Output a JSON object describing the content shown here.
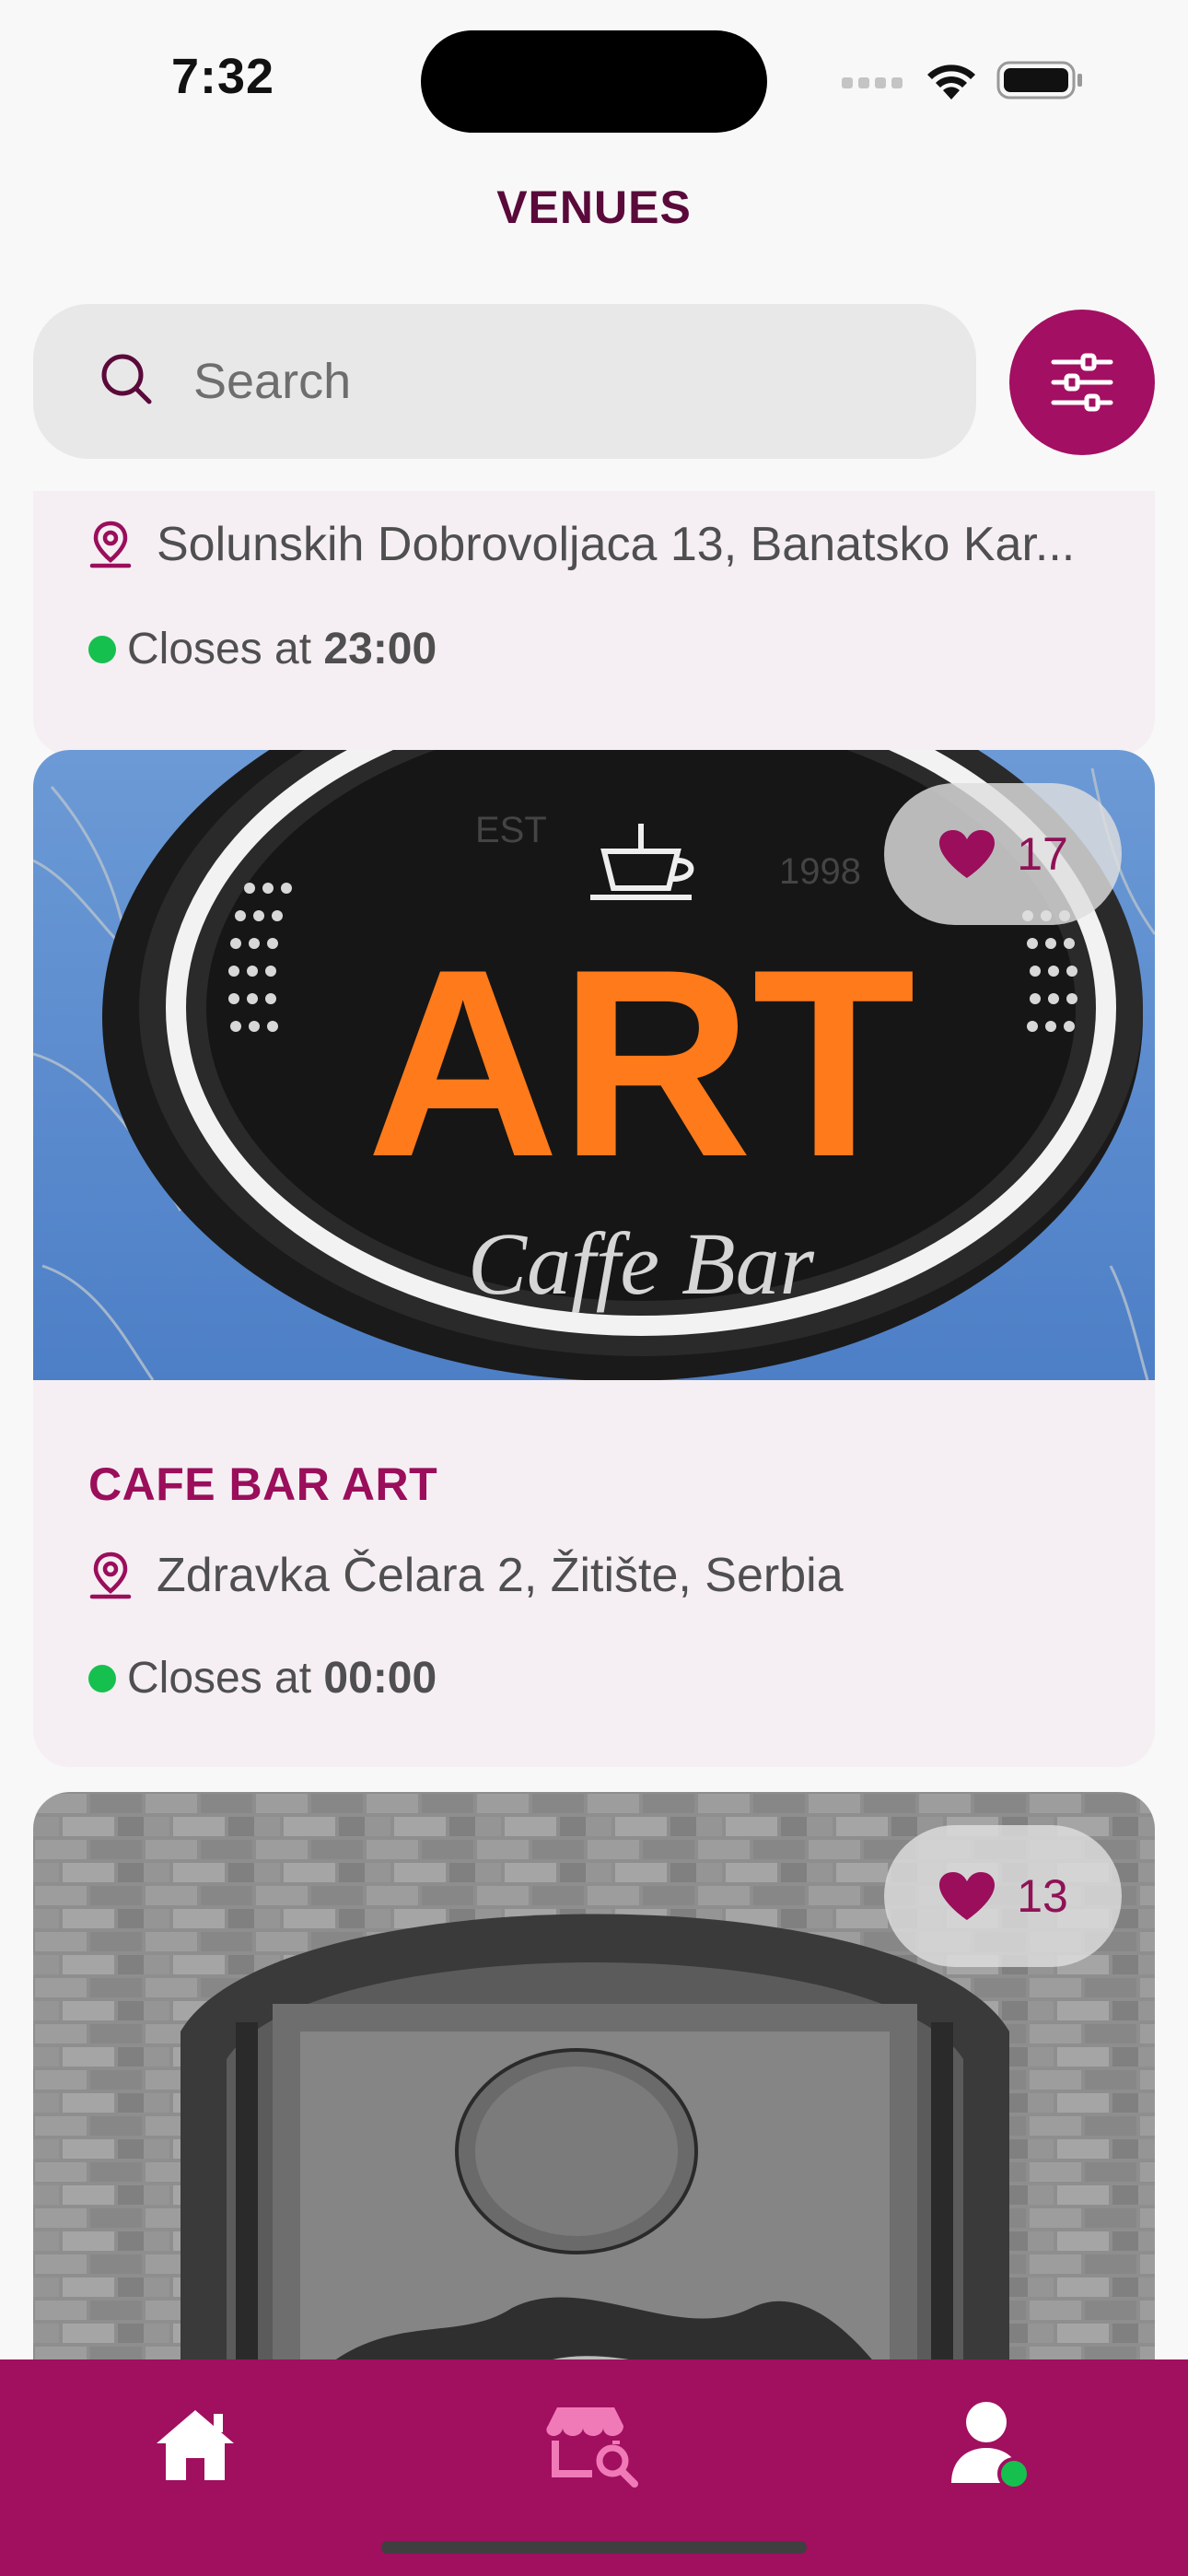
{
  "status_bar": {
    "time": "7:32"
  },
  "header": {
    "title": "VENUES"
  },
  "search": {
    "placeholder": "Search",
    "value": ""
  },
  "venues": [
    {
      "name": "",
      "address": "Solunskih Dobrovoljaca 13, Banatsko Kar...",
      "status_prefix": "Closes at ",
      "status_time": "23:00"
    },
    {
      "name": "CAFE BAR ART",
      "address": "Zdravka Čelara 2, Žitište, Serbia",
      "status_prefix": "Closes at ",
      "status_time": "00:00",
      "likes": "17",
      "image_sign": {
        "est": "EST",
        "year": "1998",
        "word": "ART",
        "script": "Caffe Bar"
      }
    },
    {
      "likes": "13"
    }
  ],
  "tab_bar": {
    "items": [
      {
        "icon": "home-icon",
        "active": false
      },
      {
        "icon": "venue-search-icon",
        "active": true
      },
      {
        "icon": "profile-icon",
        "active": false
      }
    ]
  },
  "colors": {
    "brand": "#a10f5f",
    "title": "#5a0a3a",
    "open_status": "#16c04f",
    "active_tab": "#f07ab8"
  }
}
